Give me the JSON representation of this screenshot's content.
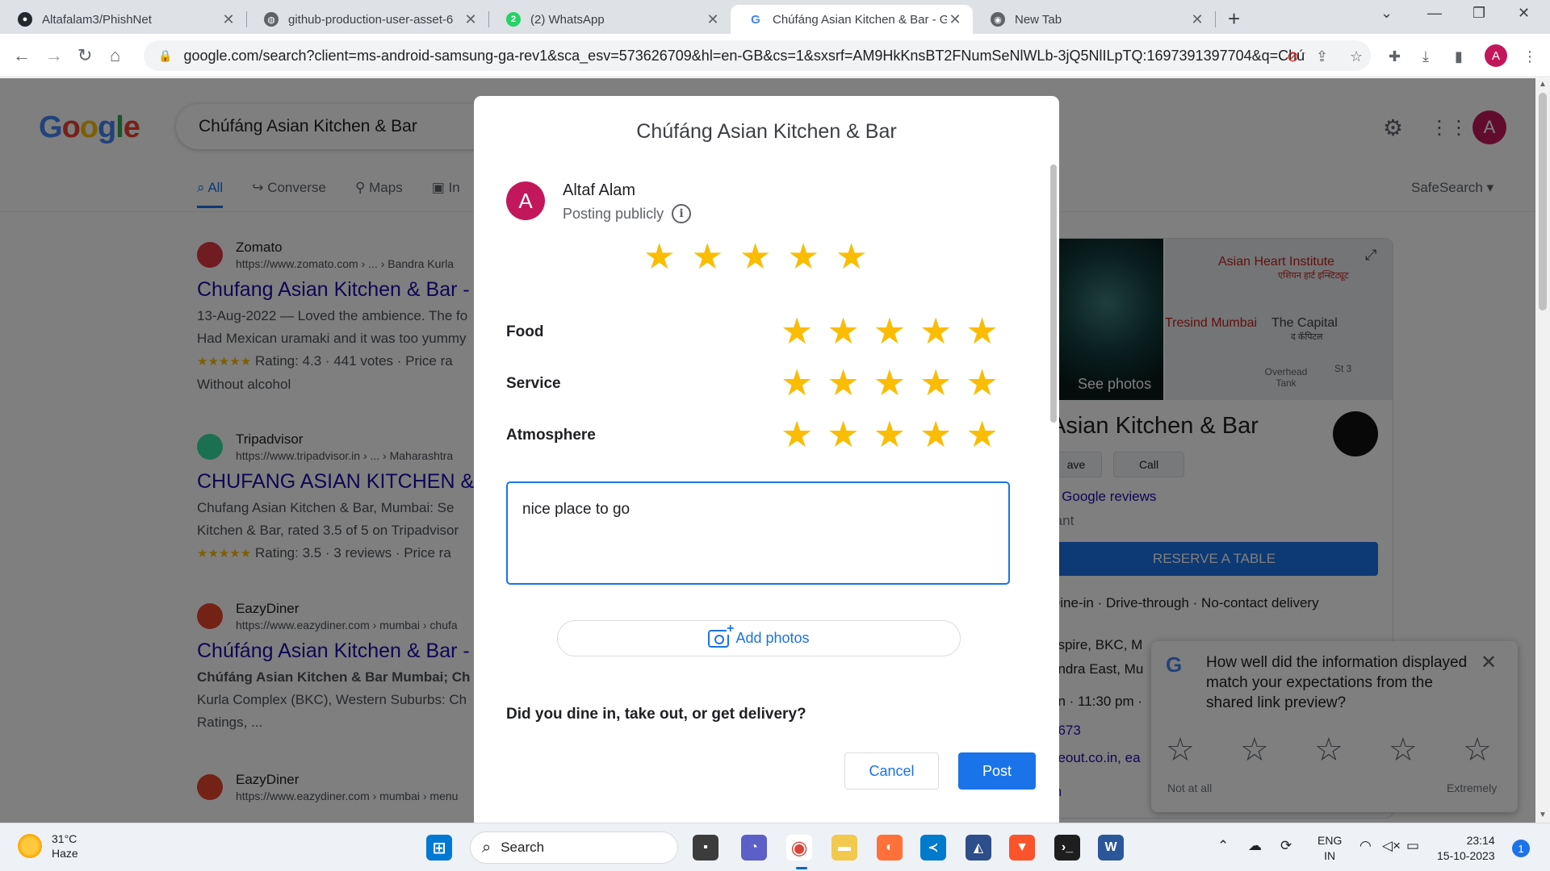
{
  "browser": {
    "tabs": [
      {
        "title": "Altafalam3/PhishNet",
        "icon": "github-icon"
      },
      {
        "title": "github-production-user-asset-6",
        "icon": "globe-icon"
      },
      {
        "title": "(2) WhatsApp",
        "icon": "whatsapp-icon"
      },
      {
        "title": "Chúfáng Asian Kitchen & Bar - G",
        "icon": "google-icon"
      },
      {
        "title": "New Tab",
        "icon": "chrome-icon"
      }
    ],
    "url": "google.com/search?client=ms-android-samsung-ga-rev1&sca_esv=573626709&hl=en-GB&cs=1&sxsrf=AM9HkKnsBT2FNumSeNlWLb-3jQ5NlILpTQ:1697391397704&q=Chúf...",
    "profile_initial": "A"
  },
  "search_page": {
    "logo": "Google",
    "query": "Chúfáng Asian Kitchen & Bar",
    "tabs": [
      "All",
      "Converse",
      "Maps",
      "In"
    ],
    "safesearch": "SafeSearch",
    "avatar_initial": "A",
    "results": [
      {
        "site": "Zomato",
        "url": "https://www.zomato.com › ... › Bandra Kurla",
        "title": "Chufang Asian Kitchen & Bar -",
        "snippet1": "13-Aug-2022 — Loved the ambience. The fo",
        "snippet2": "Had Mexican uramaki and it was too yummy",
        "stars": "★★★★★",
        "rating": "Rating: 4.3 · 441 votes · Price ra",
        "snippet3": "Without alcohol"
      },
      {
        "site": "Tripadvisor",
        "url": "https://www.tripadvisor.in › ... › Maharashtra",
        "title": "CHUFANG ASIAN KITCHEN &",
        "snippet1": "Chufang Asian Kitchen & Bar, Mumbai: Se",
        "snippet2": "Kitchen & Bar, rated 3.5 of 5 on Tripadvisor",
        "stars": "★★★★★",
        "rating": "Rating: 3.5 · 3 reviews · Price ra"
      },
      {
        "site": "EazyDiner",
        "url": "https://www.eazydiner.com › mumbai › chufa",
        "title": "Chúfáng Asian Kitchen & Bar -",
        "snippet1": "Chúfáng Asian Kitchen & Bar Mumbai; Ch",
        "snippet2": "Kurla Complex (BKC), Western Suburbs: Ch",
        "snippet3": "Ratings, ..."
      },
      {
        "site": "EazyDiner",
        "url": "https://www.eazydiner.com › mumbai › menu"
      }
    ],
    "knowledge_panel": {
      "see_photos": "See photos",
      "map_labels": [
        "Asian Heart Institute",
        "एशियन हार्ट इन्स्टिट्यूट",
        "Tresind Mumbai",
        "The Capital",
        "द कॅपिटल",
        "Overhead Tank",
        "St 3"
      ],
      "title": "Asian Kitchen & Bar",
      "save_label": "ave",
      "call_label": "Call",
      "reviews": "1 Google reviews",
      "type": "rant",
      "reserve": "RESERVE A TABLE",
      "services": "Dine-in · Drive-through · No-contact delivery",
      "address1": "nspire, BKC, M",
      "address2": "andra East, Mu",
      "hours": "on · 11:30 pm ·",
      "phone": "0673",
      "website": "neout.co.in, ea",
      "extra": "m"
    },
    "survey": {
      "question": "How well did the information displayed match your expectations from the shared link preview?",
      "low_label": "Not at all",
      "high_label": "Extremely"
    }
  },
  "dialog": {
    "title": "Chúfáng Asian Kitchen & Bar",
    "user_initial": "A",
    "user_name": "Altaf Alam",
    "posting": "Posting publicly",
    "overall_rating": 5,
    "categories": [
      {
        "label": "Food",
        "rating": 5
      },
      {
        "label": "Service",
        "rating": 5
      },
      {
        "label": "Atmosphere",
        "rating": 5
      }
    ],
    "review_text": "nice place to go",
    "add_photos": "Add photos",
    "question": "Did you dine in, take out, or get delivery?",
    "cancel": "Cancel",
    "post": "Post"
  },
  "taskbar": {
    "temperature": "31°C",
    "weather": "Haze",
    "search": "Search",
    "lang1": "ENG",
    "lang2": "IN",
    "time": "23:14",
    "date": "15-10-2023",
    "notifications": "1"
  }
}
